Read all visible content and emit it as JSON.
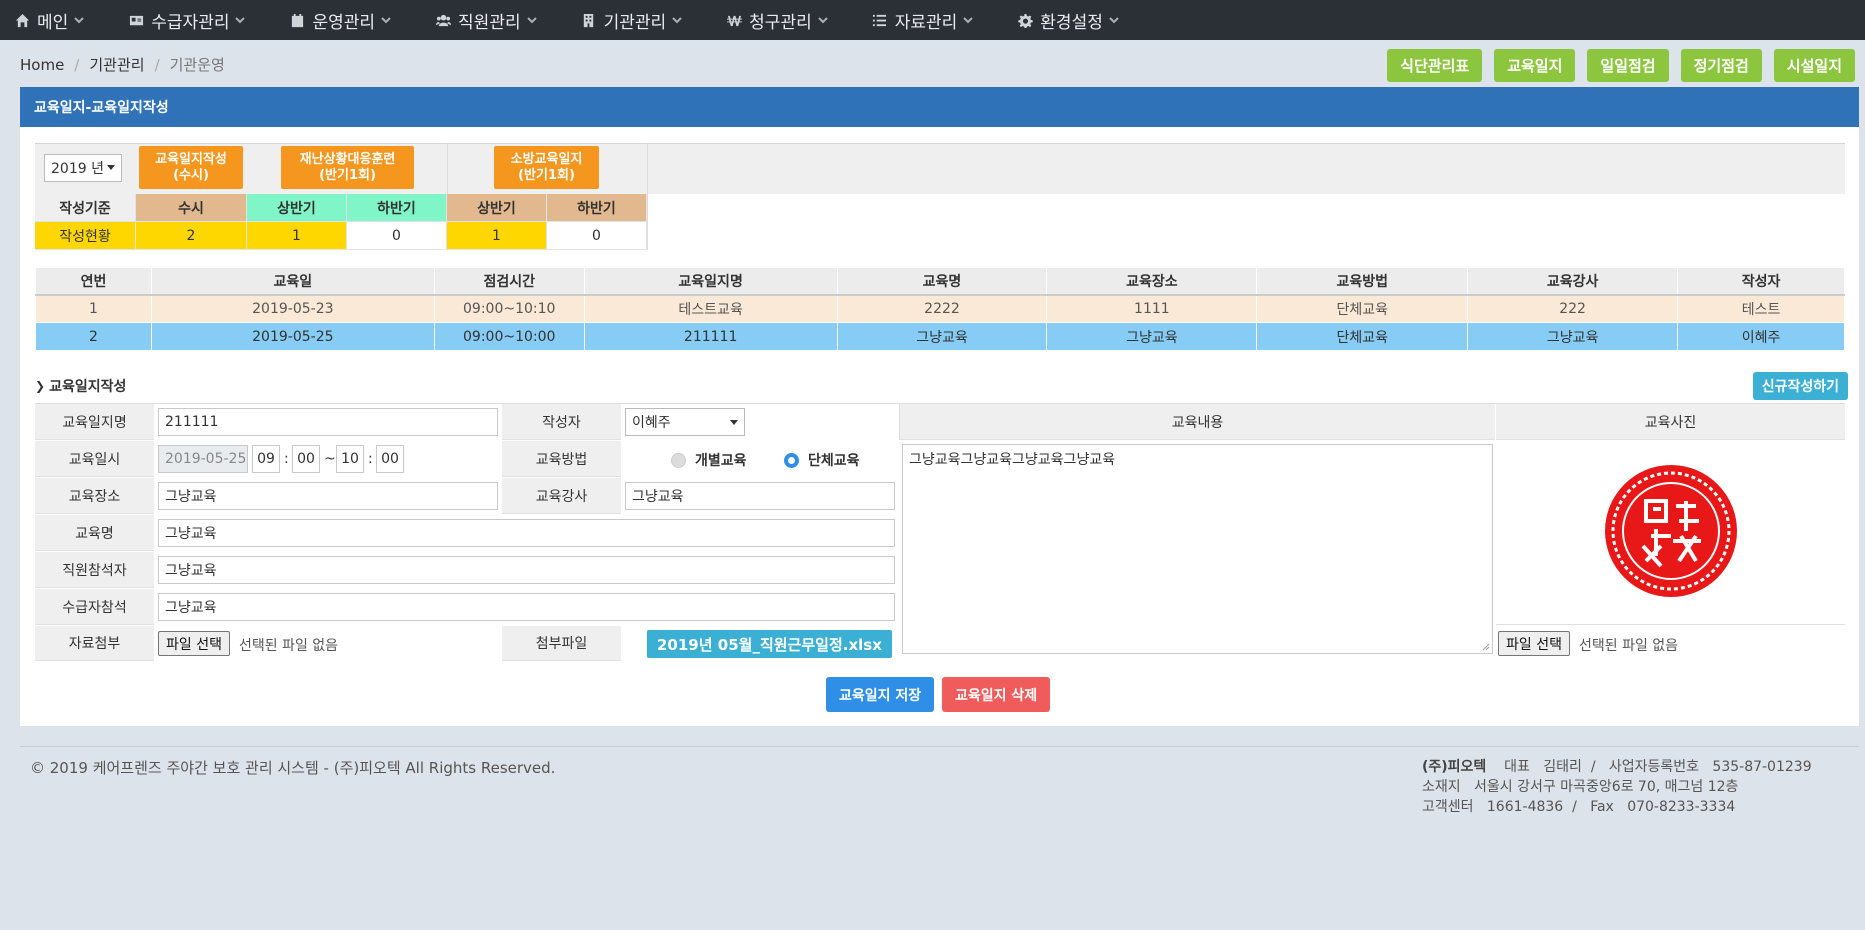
{
  "nav": {
    "items": [
      {
        "label": "메인",
        "icon": "home-icon"
      },
      {
        "label": "수급자관리",
        "icon": "id-card-icon"
      },
      {
        "label": "운영관리",
        "icon": "calendar-icon"
      },
      {
        "label": "직원관리",
        "icon": "users-icon"
      },
      {
        "label": "기관관리",
        "icon": "building-icon"
      },
      {
        "label": "청구관리",
        "icon": "won-icon"
      },
      {
        "label": "자료관리",
        "icon": "list-icon"
      },
      {
        "label": "환경설정",
        "icon": "gear-icon"
      }
    ]
  },
  "breadcrumb": {
    "home": "Home",
    "parent": "기관관리",
    "current": "기관운영"
  },
  "quick": [
    "식단관리표",
    "교육일지",
    "일일점검",
    "정기점검",
    "시설일지"
  ],
  "panel": {
    "title": "교육일지-교육일지작성"
  },
  "summary": {
    "year": "2019 년",
    "btn_edu": [
      "교육일지작성",
      "(수시)"
    ],
    "btn_disaster": [
      "재난상황대응훈련",
      "(반기1회)"
    ],
    "btn_fire": [
      "소방교육일지",
      "(반기1회)"
    ],
    "row_basis": [
      "작성기준",
      "수시",
      "상반기",
      "하반기",
      "상반기",
      "하반기"
    ],
    "row_status": [
      "작성현황",
      "2",
      "1",
      "0",
      "1",
      "0"
    ],
    "colors": {
      "tan": "#e2b98f",
      "mint": "#7ff5c8",
      "yellow": "#ffd700"
    }
  },
  "grid": {
    "headers": [
      "연번",
      "교육일",
      "점검시간",
      "교육일지명",
      "교육명",
      "교육장소",
      "교육방법",
      "교육강사",
      "작성자"
    ],
    "rows": [
      [
        "1",
        "2019-05-23",
        "09:00~10:10",
        "테스트교육",
        "2222",
        "1111",
        "단체교육",
        "222",
        "테스트"
      ],
      [
        "2",
        "2019-05-25",
        "09:00~10:00",
        "211111",
        "그냥교육",
        "그냥교육",
        "단체교육",
        "그냥교육",
        "이혜주"
      ]
    ]
  },
  "form": {
    "section_title": "교육일지작성",
    "new_btn": "신규작성하기",
    "labels": {
      "name": "교육일지명",
      "datetime": "교육일시",
      "place": "교육장소",
      "title": "교육명",
      "staff": "직원참석자",
      "client": "수급자참석",
      "attach": "자료첨부",
      "writer": "작성자",
      "method": "교육방법",
      "teacher": "교육강사",
      "file": "첨부파일",
      "content": "교육내용",
      "photo": "교육사진"
    },
    "values": {
      "name": "211111",
      "date": "2019-05-25",
      "h1": "09",
      "m1": "00",
      "tilde": "~",
      "h2": "10",
      "m2": "00",
      "colon": ":",
      "place": "그냥교육",
      "title": "그냥교육",
      "staff": "그냥교육",
      "client": "그냥교육",
      "writer": "이혜주",
      "method_a": "개별교육",
      "method_b": "단체교육",
      "teacher": "그냥교육",
      "content": "그냥교육그냥교육그냥교육그냥교육",
      "file_name": "2019년 05월_직원근무일정.xlsx",
      "choose_file": "파일 선택",
      "no_file": "선택된 파일 없음"
    },
    "method_selected": "단체교육",
    "save": "교육일지 저장",
    "delete": "교육일지 삭제"
  },
  "footer": {
    "copyright": "© 2019 케어프렌즈 주야간 보호 관리 시스템 - (주)피오텍 All Rights Reserved.",
    "company": "(주)피오텍",
    "ceo_label": "대표",
    "ceo": "김태리",
    "slash": "/",
    "biz_label": "사업자등록번호",
    "biz": "535-87-01239",
    "addr_label": "소재지",
    "addr": "서울시 강서구 마곡중앙6로 70, 매그넘 12층",
    "cs_label": "고객센터",
    "cs": "1661-4836",
    "fax_label": "Fax",
    "fax": "070-8233-3334"
  }
}
